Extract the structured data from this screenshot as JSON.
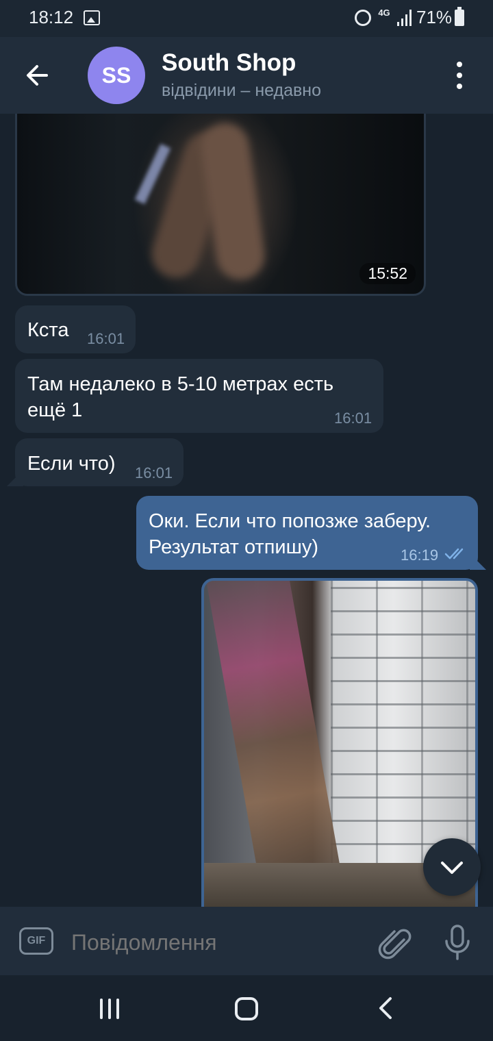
{
  "status_bar": {
    "time": "18:12",
    "network": "4G",
    "battery": "71%",
    "icons": [
      "gallery-icon",
      "alarm-icon",
      "4g-data-icon",
      "signal-icon",
      "battery-icon"
    ]
  },
  "header": {
    "avatar_initials": "SS",
    "avatar_color": "#8e85ee",
    "title": "South Shop",
    "subtitle": "відвідини – недавно",
    "icons": [
      "back-arrow-icon",
      "more-vertical-icon"
    ]
  },
  "messages": [
    {
      "type": "media",
      "direction": "incoming",
      "time": "15:52"
    },
    {
      "type": "text",
      "direction": "incoming",
      "text": "Кста",
      "time": "16:01"
    },
    {
      "type": "text",
      "direction": "incoming",
      "text_lines": [
        "Там недалеко в 5-10 метрах есть",
        "ещё 1"
      ],
      "time": "16:01"
    },
    {
      "type": "text",
      "direction": "incoming",
      "text": "Если что)",
      "time": "16:01"
    },
    {
      "type": "text",
      "direction": "outgoing",
      "text_lines": [
        "Оки. Если что попозже заберу.",
        "Результат отпишу)"
      ],
      "time": "16:19",
      "status": "read"
    },
    {
      "type": "media",
      "direction": "outgoing"
    }
  ],
  "composer": {
    "gif_label": "GIF",
    "placeholder": "Повідомлення",
    "icons": [
      "gif-icon",
      "attach-paperclip-icon",
      "microphone-icon"
    ]
  },
  "scroll_button_icon": "chevron-down-icon",
  "nav_bar": {
    "icons": [
      "recent-apps-icon",
      "home-icon",
      "back-icon"
    ]
  },
  "colors": {
    "background": "#18222d",
    "header": "#212d3b",
    "incoming_bubble": "#222e3b",
    "outgoing_bubble": "#3e6493",
    "accent": "#8e85ee"
  }
}
